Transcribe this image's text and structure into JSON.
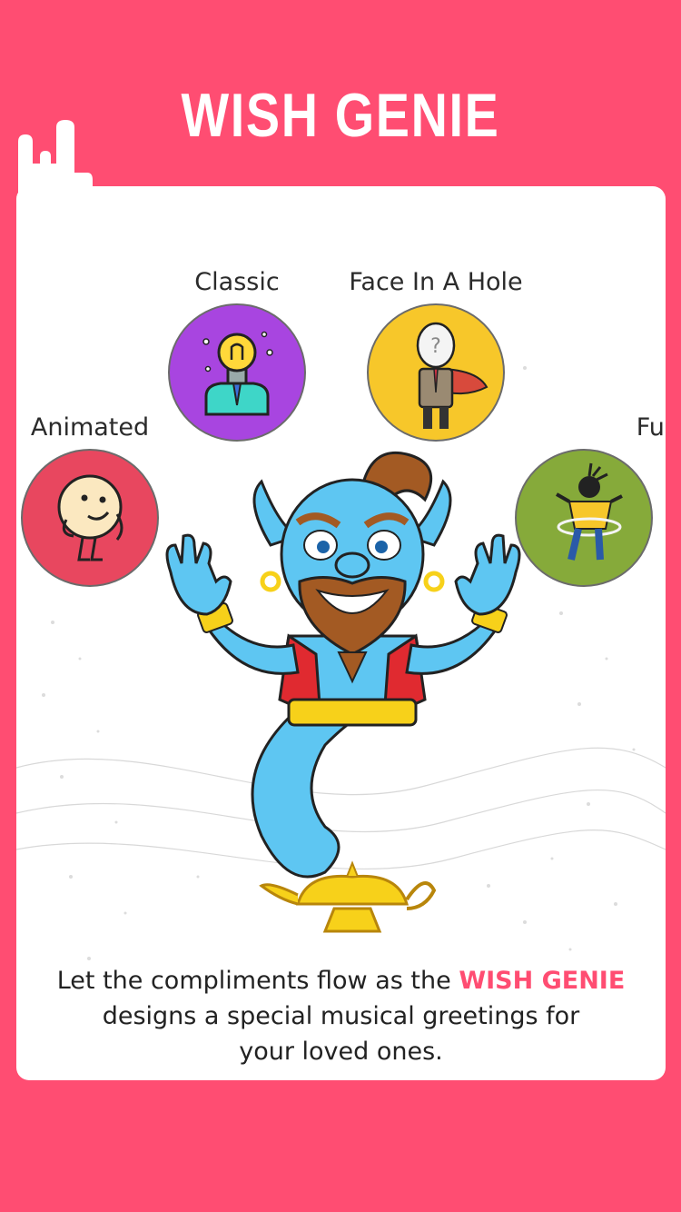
{
  "header": {
    "title": "WISH GENIE"
  },
  "categories": [
    {
      "label": "Classic",
      "color": "#a845e0",
      "icon": "lightbulb-head-icon"
    },
    {
      "label": "Face In A Hole",
      "color": "#f7c72a",
      "icon": "face-in-hole-icon"
    },
    {
      "label": "Animated",
      "color": "#e8475f",
      "icon": "cartoon-face-icon"
    },
    {
      "label": "Fun",
      "color": "#86aa3a",
      "icon": "hula-hoop-dancer-icon"
    }
  ],
  "caption": {
    "part1": "Let the  compliments flow as the ",
    "highlight": "WISH GENIE",
    "part2": "designs a special musical greetings for",
    "part3": "your loved ones."
  },
  "colors": {
    "background": "#ff4d72",
    "accent": "#ff4d72",
    "card": "#ffffff"
  }
}
